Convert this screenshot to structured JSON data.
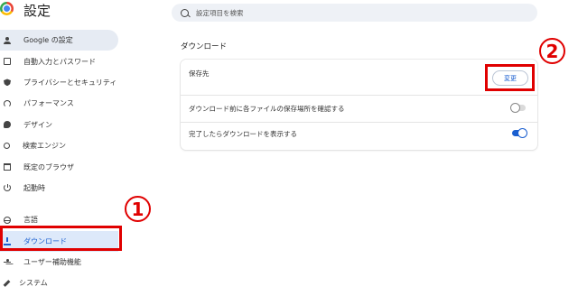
{
  "header": {
    "title": "設定"
  },
  "search": {
    "placeholder": "設定項目を検索"
  },
  "sidebar": {
    "items": [
      {
        "label": "Google の設定",
        "icon": "person-icon"
      },
      {
        "label": "自動入力とパスワード",
        "icon": "clipboard-icon"
      },
      {
        "label": "プライバシーとセキュリティ",
        "icon": "shield-icon"
      },
      {
        "label": "パフォーマンス",
        "icon": "speedometer-icon"
      },
      {
        "label": "デザイン",
        "icon": "palette-icon"
      },
      {
        "label": "検索エンジン",
        "icon": "search-icon"
      },
      {
        "label": "既定のブラウザ",
        "icon": "browser-icon"
      },
      {
        "label": "起動時",
        "icon": "power-icon"
      },
      {
        "label": "言語",
        "icon": "globe-icon"
      },
      {
        "label": "ダウンロード",
        "icon": "download-icon"
      },
      {
        "label": "ユーザー補助機能",
        "icon": "accessibility-icon"
      },
      {
        "label": "システム",
        "icon": "wrench-icon"
      }
    ]
  },
  "main": {
    "section_title": "ダウンロード",
    "location_label": "保存先",
    "change_button": "変更",
    "ask_where_label": "ダウンロード前に各ファイルの保存場所を確認する",
    "ask_where_enabled": false,
    "show_downloads_label": "完了したらダウンロードを表示する",
    "show_downloads_enabled": true
  },
  "annotations": {
    "step1": "1",
    "step2": "2",
    "color": "#e00000"
  },
  "colors": {
    "accent": "#1a5fd0",
    "selected_bg": "#e6ebf3",
    "highlight_bg": "#dde9fa"
  }
}
